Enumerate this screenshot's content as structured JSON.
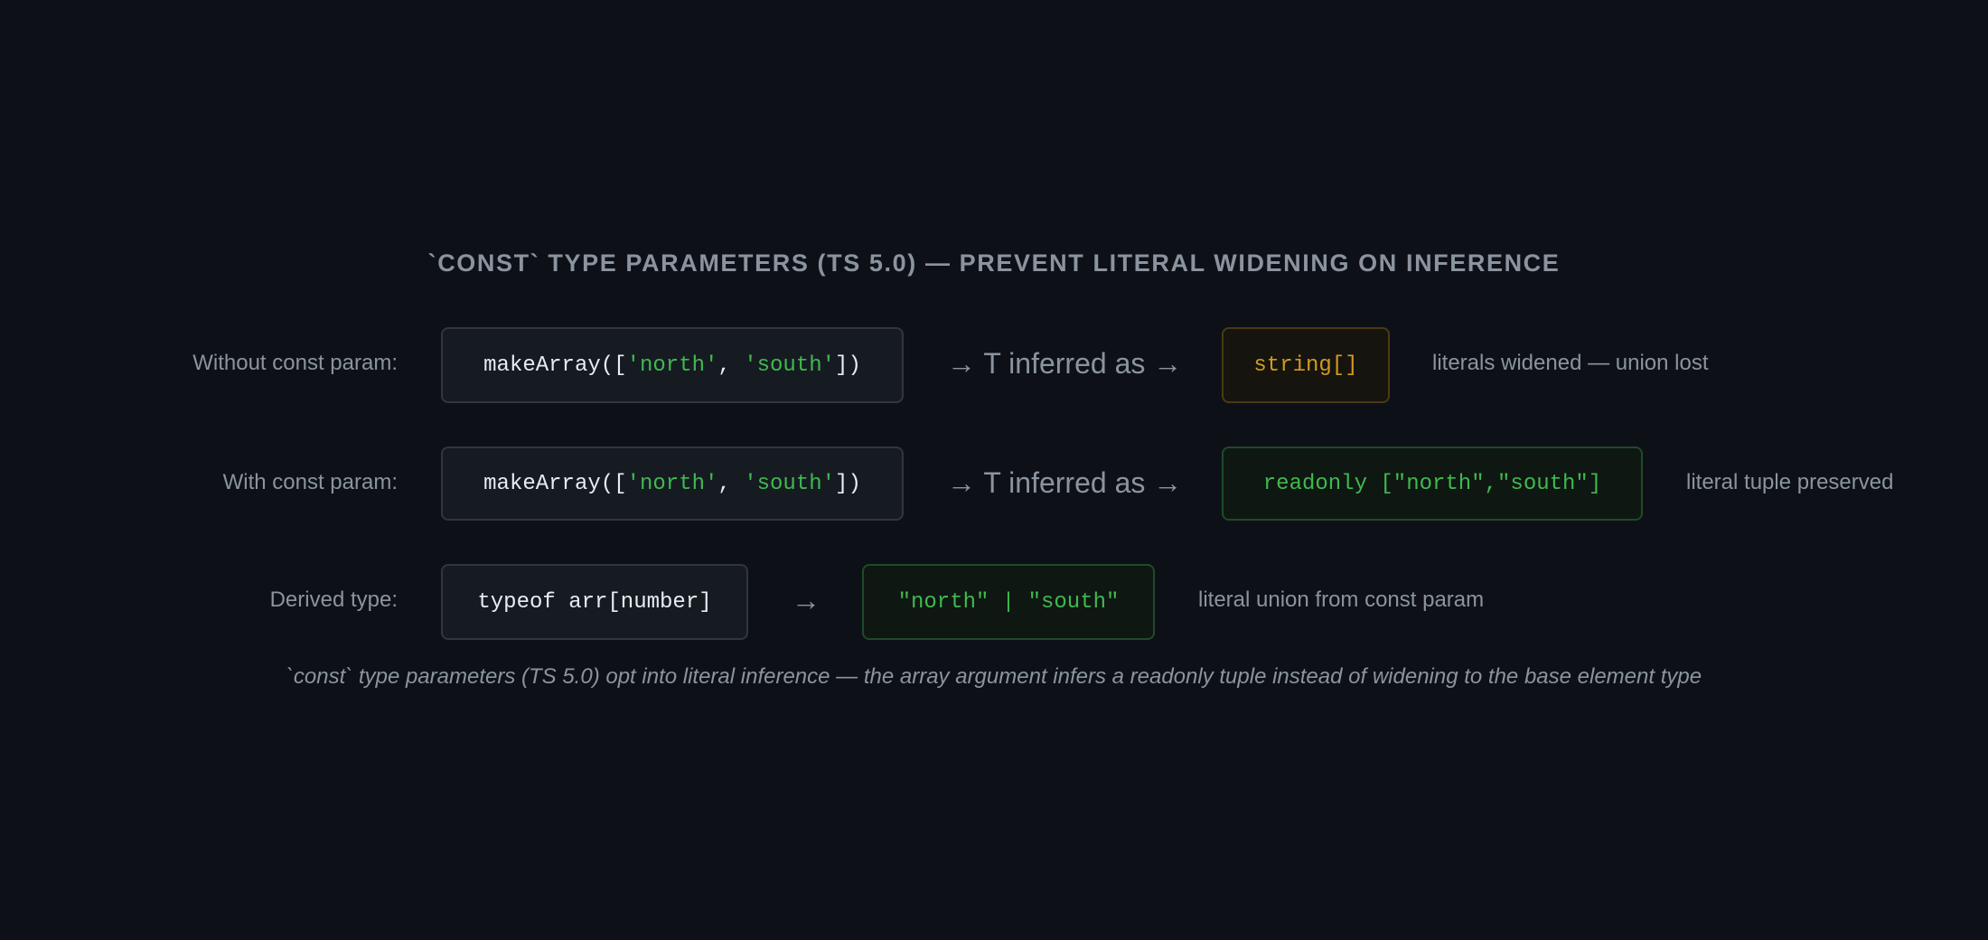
{
  "title": "`const` type parameters (TS 5.0) — prevent literal widening on inference",
  "rows": [
    {
      "label": "Without const param:",
      "code": {
        "prefix": "makeArray([",
        "s1": "'north'",
        "sep": ", ",
        "s2": "'south'",
        "suffix": "])"
      },
      "arrow_text": "→ T inferred as →",
      "result": "string[]",
      "note": "literals widened — union lost"
    },
    {
      "label": "With const param:",
      "code": {
        "prefix": "makeArray([",
        "s1": "'north'",
        "sep": ", ",
        "s2": "'south'",
        "suffix": "])"
      },
      "arrow_text": "→ T inferred as →",
      "result": "readonly [\"north\",\"south\"]",
      "note": "literal tuple preserved"
    },
    {
      "label": "Derived type:",
      "code_text": "typeof arr[number]",
      "arrow_text": "→",
      "result": "\"north\" | \"south\"",
      "note": "literal union from const param"
    }
  ],
  "caption": "`const` type parameters (TS 5.0) opt into literal inference — the array argument infers a readonly tuple instead of widening to the base element type",
  "colors": {
    "background": "#0d1117",
    "string_literal": "#3fb950",
    "widened": "#d29922",
    "preserved": "#3fb950",
    "muted_text": "#8b949e"
  }
}
